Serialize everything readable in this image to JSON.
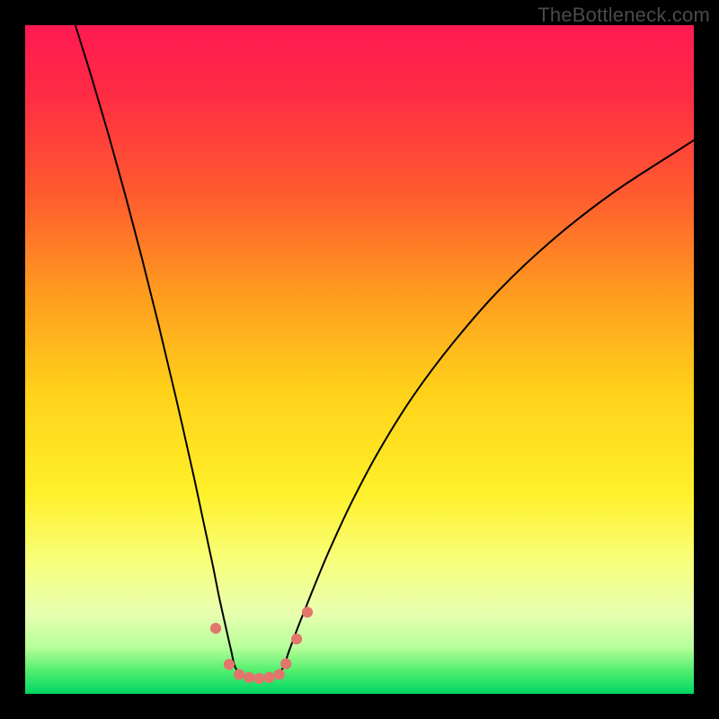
{
  "watermark": "TheBottleneck.com",
  "chart_data": {
    "type": "line",
    "title": "",
    "xlabel": "",
    "ylabel": "",
    "xlim": [
      0,
      100
    ],
    "ylim": [
      0,
      100
    ],
    "gradient_stops": [
      {
        "offset": 0.0,
        "color": "#ff1a52"
      },
      {
        "offset": 0.1,
        "color": "#ff2b45"
      },
      {
        "offset": 0.25,
        "color": "#ff5a2f"
      },
      {
        "offset": 0.4,
        "color": "#ff9b1f"
      },
      {
        "offset": 0.55,
        "color": "#ffd21a"
      },
      {
        "offset": 0.7,
        "color": "#fff02a"
      },
      {
        "offset": 0.8,
        "color": "#f8ff7a"
      },
      {
        "offset": 0.88,
        "color": "#e8ffb0"
      },
      {
        "offset": 0.93,
        "color": "#b8ff9a"
      },
      {
        "offset": 0.965,
        "color": "#53ef6e"
      },
      {
        "offset": 1.0,
        "color": "#00d665"
      }
    ],
    "series": [
      {
        "name": "left-branch",
        "x": [
          7.5,
          10,
          12.5,
          15,
          17.5,
          20,
          22.5,
          25,
          26.5,
          28,
          29,
          30,
          30.8,
          31.5
        ],
        "y": [
          100,
          92,
          83.5,
          74.5,
          65,
          55,
          44.5,
          33.5,
          26.5,
          19.5,
          14.5,
          10,
          6.5,
          3.8
        ]
      },
      {
        "name": "right-branch",
        "x": [
          38.5,
          39.5,
          41,
          43,
          45.5,
          49,
          53,
          58,
          64,
          71,
          79,
          88,
          98,
          100
        ],
        "y": [
          3.8,
          6.5,
          10.5,
          15.5,
          21.5,
          29,
          36.5,
          44.5,
          52.5,
          60.5,
          68,
          75,
          81.5,
          82.8
        ]
      },
      {
        "name": "valley-floor",
        "x": [
          31.5,
          33,
          35,
          37,
          38.5
        ],
        "y": [
          3.8,
          2.6,
          2.3,
          2.6,
          3.8
        ]
      }
    ],
    "markers": {
      "name": "highlighted-points",
      "color": "#e2766d",
      "x": [
        28.5,
        30.5,
        32.0,
        33.5,
        35.0,
        36.5,
        38.0,
        39.0,
        40.6,
        42.2
      ],
      "y": [
        9.8,
        4.4,
        2.9,
        2.45,
        2.3,
        2.45,
        2.9,
        4.5,
        8.2,
        12.2
      ],
      "r": [
        6.1,
        6.1,
        6.1,
        6.1,
        6.1,
        6.1,
        6.1,
        6.1,
        6.1,
        6.1
      ]
    }
  }
}
